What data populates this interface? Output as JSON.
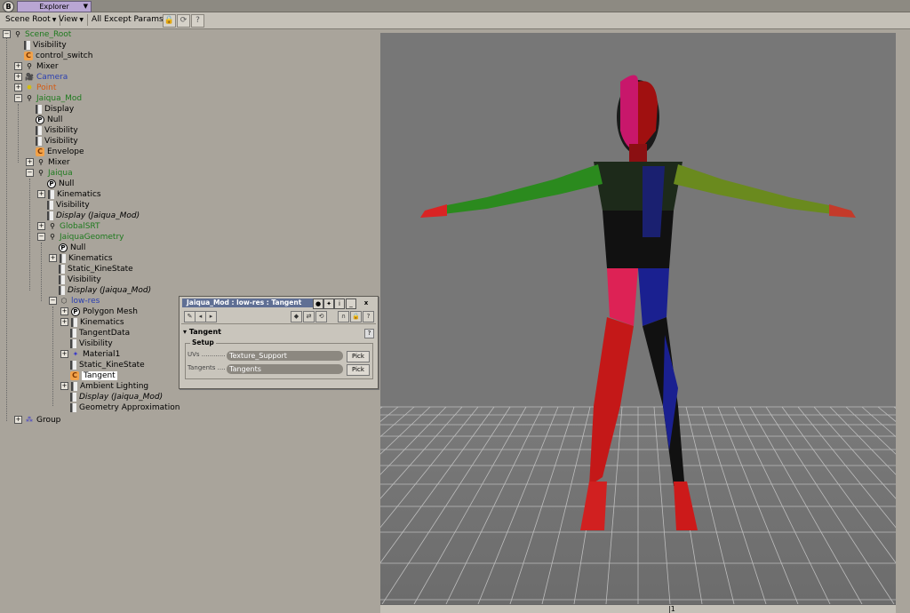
{
  "window": {
    "tab_title": "Explorer"
  },
  "toolbar": {
    "scene_root": "Scene Root",
    "view": "View",
    "filter": "All Except Params"
  },
  "tree": [
    {
      "label": "Scene_Root",
      "icon": "figure-icon",
      "color": "green"
    },
    {
      "label": "Visibility",
      "icon": "param-icon"
    },
    {
      "label": "control_switch",
      "icon": "custom-param-icon"
    },
    {
      "label": "Mixer",
      "icon": "figure-icon"
    },
    {
      "label": "Camera",
      "icon": "camera-icon",
      "color": "blue"
    },
    {
      "label": "Point",
      "icon": "light-icon",
      "color": "orange"
    },
    {
      "label": "Jaiqua_Mod",
      "icon": "figure-icon",
      "color": "green"
    },
    {
      "label": "Display",
      "icon": "param-icon"
    },
    {
      "label": "Null",
      "icon": "null-icon"
    },
    {
      "label": "Visibility",
      "icon": "param-icon"
    },
    {
      "label": "Visibility",
      "icon": "param-icon"
    },
    {
      "label": "Envelope",
      "icon": "custom-param-icon"
    },
    {
      "label": "Mixer",
      "icon": "figure-icon"
    },
    {
      "label": "Jaiqua",
      "icon": "figure-icon",
      "color": "green"
    },
    {
      "label": "Null",
      "icon": "null-icon"
    },
    {
      "label": "Kinematics",
      "icon": "param-icon"
    },
    {
      "label": "Visibility",
      "icon": "param-icon"
    },
    {
      "label": "Display (Jaiqua_Mod)",
      "icon": "param-icon",
      "italic": true
    },
    {
      "label": "GlobalSRT",
      "icon": "figure-icon",
      "color": "green"
    },
    {
      "label": "JaiquaGeometry",
      "icon": "figure-icon",
      "color": "green"
    },
    {
      "label": "Null",
      "icon": "null-icon"
    },
    {
      "label": "Kinematics",
      "icon": "param-icon"
    },
    {
      "label": "Static_KineState",
      "icon": "param-icon"
    },
    {
      "label": "Visibility",
      "icon": "param-icon"
    },
    {
      "label": "Display (Jaiqua_Mod)",
      "icon": "param-icon",
      "italic": true
    },
    {
      "label": "low-res",
      "icon": "mesh-icon",
      "color": "blue"
    },
    {
      "label": "Polygon Mesh",
      "icon": "null-icon"
    },
    {
      "label": "Kinematics",
      "icon": "param-icon"
    },
    {
      "label": "TangentData",
      "icon": "param-icon"
    },
    {
      "label": "Visibility",
      "icon": "param-icon"
    },
    {
      "label": "Material1",
      "icon": "material-icon"
    },
    {
      "label": "Static_KineState",
      "icon": "param-icon"
    },
    {
      "label": "Tangent",
      "icon": "custom-param-icon",
      "selected": true
    },
    {
      "label": "Ambient Lighting",
      "icon": "param-icon"
    },
    {
      "label": "Display (Jaiqua_Mod)",
      "icon": "param-icon",
      "italic": true
    },
    {
      "label": "Geometry Approximation",
      "icon": "param-icon"
    },
    {
      "label": "Group",
      "icon": "group-icon"
    }
  ],
  "panel": {
    "title": "Jaiqua_Mod : low-res : Tangent",
    "section": "Tangent",
    "group": "Setup",
    "uvs_label": "UVs",
    "uvs_value": "Texture_Support",
    "tangents_label": "Tangents",
    "tangents_value": "Tangents",
    "pick_label": "Pick"
  },
  "colors": {
    "green": "#1e7a1e",
    "orange": "#d55a12",
    "blue": "#2a3fb1",
    "viewport_bg": "#777777"
  }
}
